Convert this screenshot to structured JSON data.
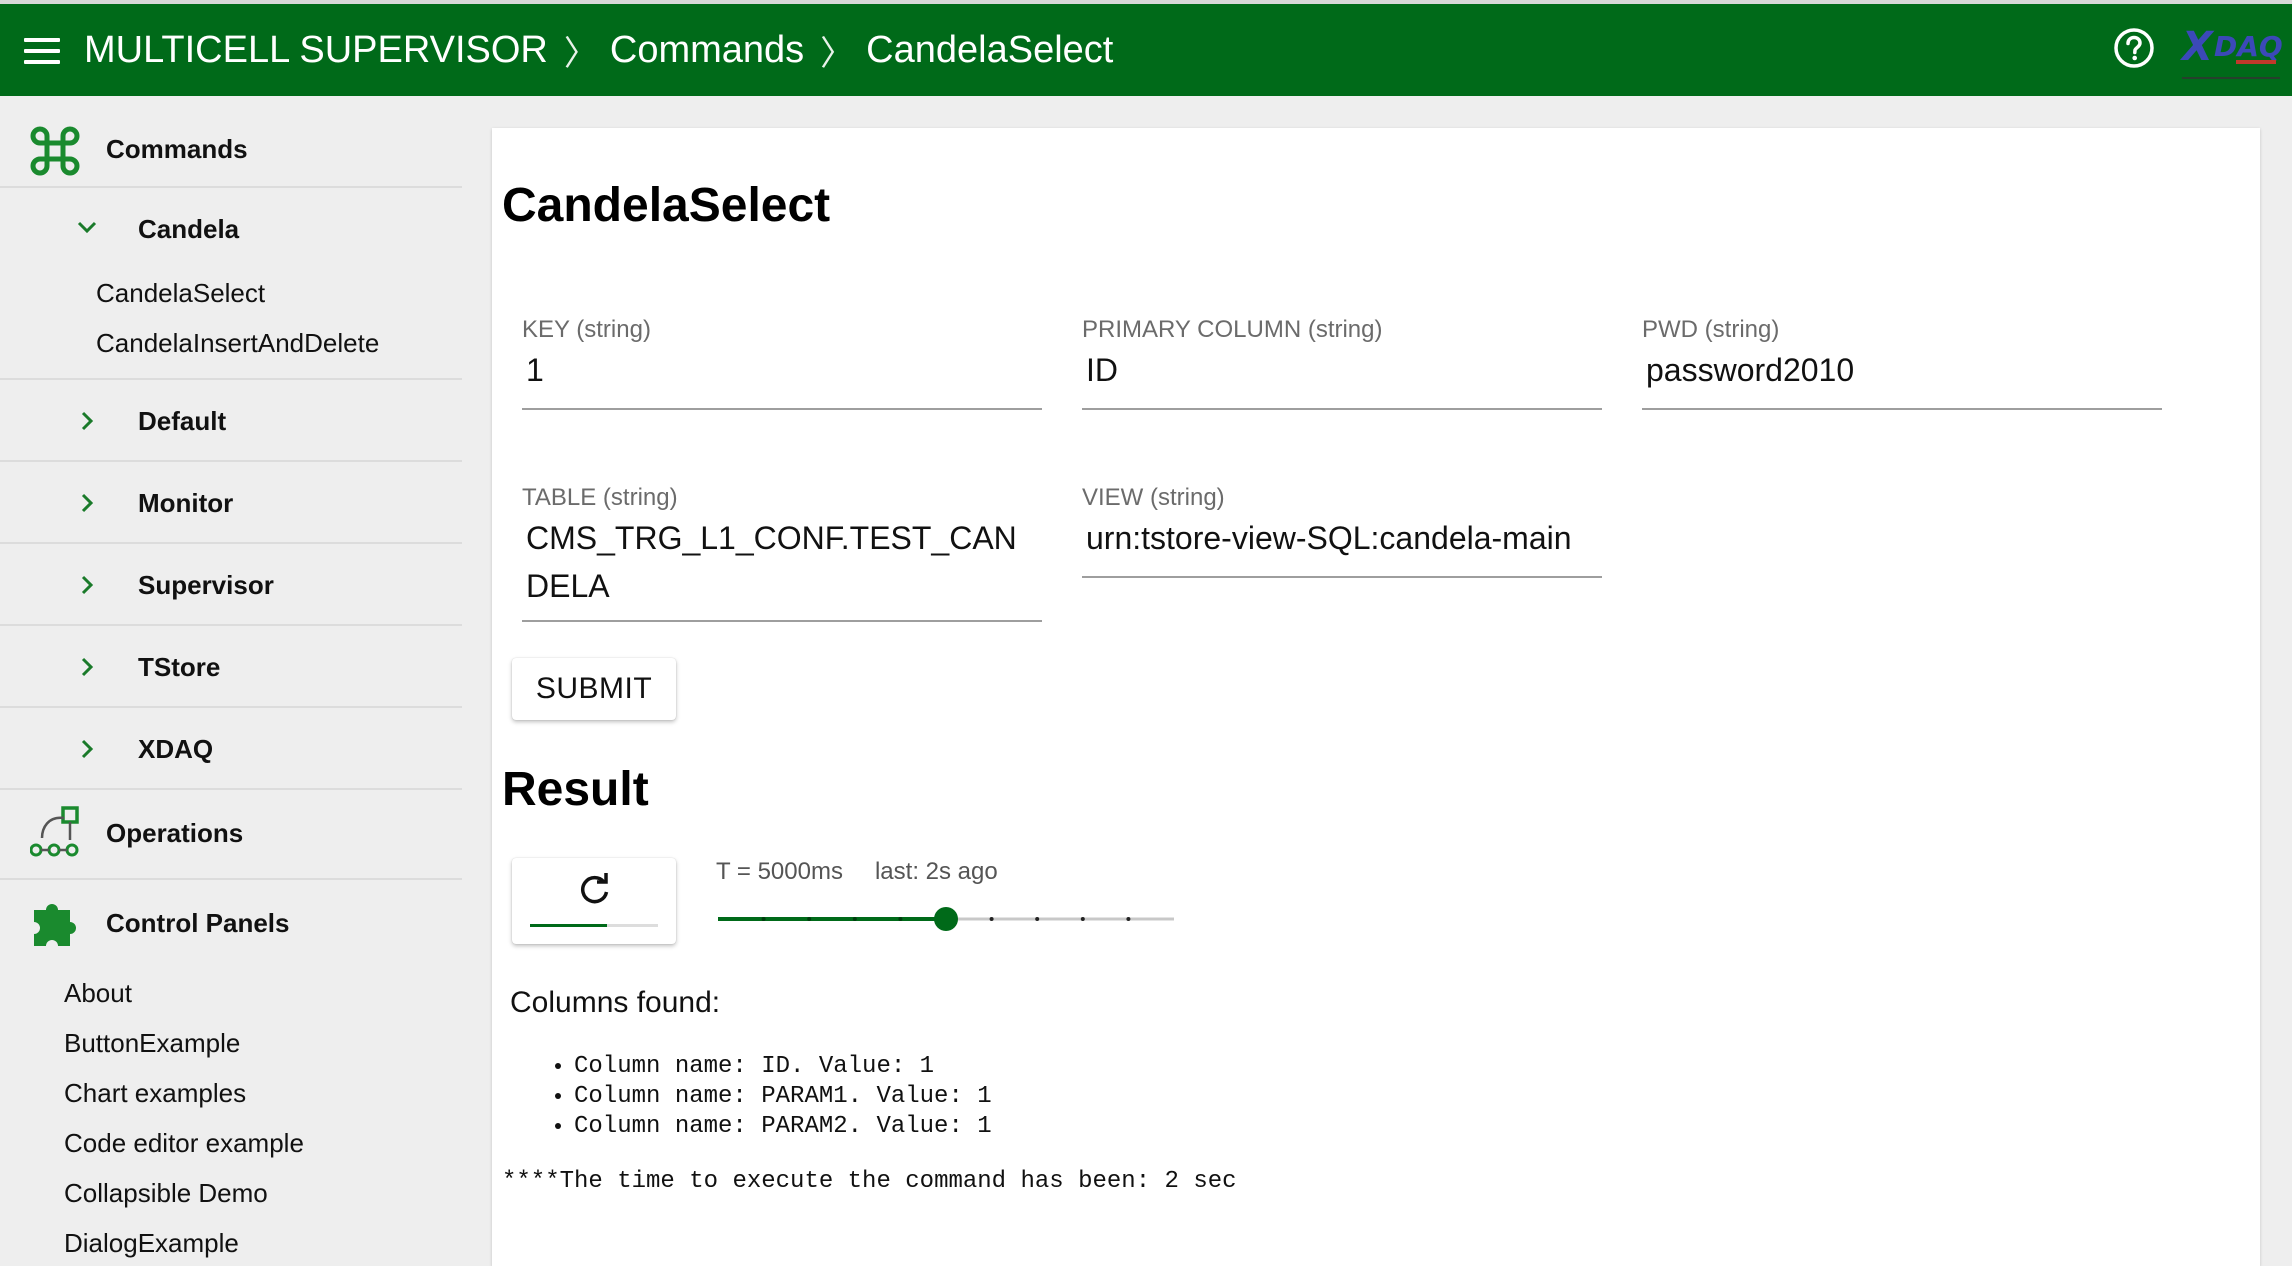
{
  "header": {
    "app_title": "MULTICELL SUPERVISOR",
    "breadcrumb": [
      "Commands",
      "CandelaSelect"
    ],
    "separator": "〉",
    "background_color": "#006a19",
    "menu_icon": "hamburger-menu-icon",
    "help_icon": "help-circle-icon",
    "logo_text": "XDAQ"
  },
  "sidebar": {
    "sections": [
      {
        "label": "Commands",
        "icon": "command-icon"
      },
      {
        "label": "Operations",
        "icon": "operations-flow-icon"
      },
      {
        "label": "Control Panels",
        "icon": "puzzle-piece-icon"
      }
    ],
    "command_groups": [
      {
        "label": "Candela",
        "expanded": true,
        "items": [
          "CandelaSelect",
          "CandelaInsertAndDelete"
        ]
      },
      {
        "label": "Default",
        "expanded": false
      },
      {
        "label": "Monitor",
        "expanded": false
      },
      {
        "label": "Supervisor",
        "expanded": false
      },
      {
        "label": "TStore",
        "expanded": false
      },
      {
        "label": "XDAQ",
        "expanded": false
      }
    ],
    "control_panels": [
      "About",
      "ButtonExample",
      "Chart examples",
      "Code editor example",
      "Collapsible Demo",
      "DialogExample"
    ]
  },
  "main": {
    "title": "CandelaSelect",
    "fields": [
      {
        "label": "KEY (string)",
        "value": "1"
      },
      {
        "label": "PRIMARY COLUMN (string)",
        "value": "ID"
      },
      {
        "label": "PWD (string)",
        "value": "password2010"
      },
      {
        "label": "TABLE (string)",
        "value": "CMS_TRG_L1_CONF.TEST_CANDELA"
      },
      {
        "label": "VIEW (string)",
        "value": "urn:tstore-view-SQL:candela-main"
      }
    ],
    "submit_label": "SUBMIT",
    "result_title": "Result",
    "refresh": {
      "icon": "refresh-icon",
      "progress_fraction": 0.6,
      "period_text": "T = 5000ms",
      "last_text": "last: 2s ago",
      "slider_steps": 10,
      "slider_value_step": 5
    },
    "columns_label": "Columns found:",
    "columns": [
      "Column name: ID. Value: 1",
      "Column name: PARAM1. Value: 1",
      "Column name: PARAM2. Value: 1"
    ],
    "exec_time_text": "****The time to execute the command has been: 2 sec"
  }
}
